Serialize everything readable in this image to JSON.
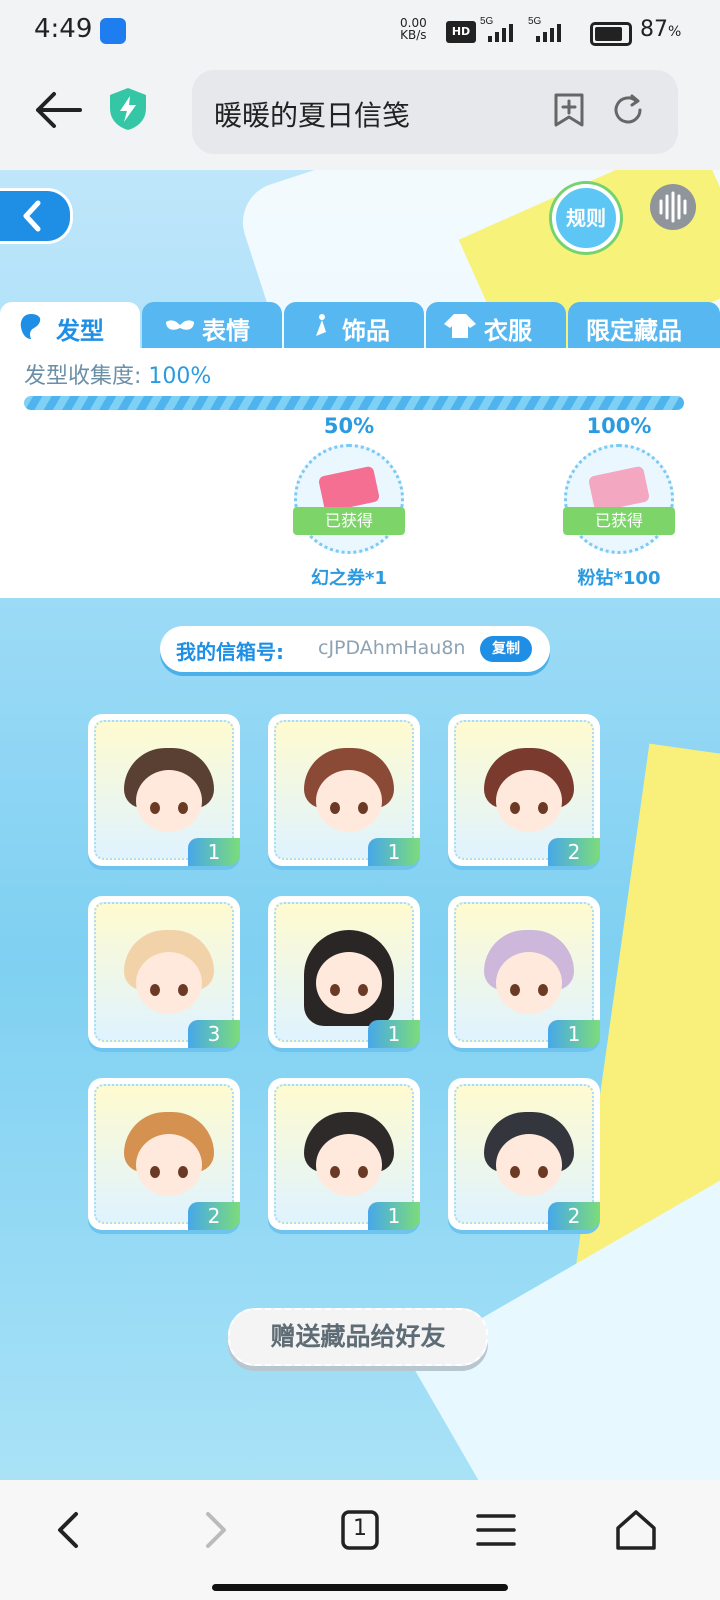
{
  "status_bar": {
    "time": "4:49",
    "net_speed_value": "0.00",
    "net_speed_unit": "KB/s",
    "hd_badge": "HD",
    "signal_labels": [
      "5G",
      "5G"
    ],
    "battery_percent": "87",
    "percent_sign": "%"
  },
  "browser": {
    "title": "暖暖的夏日信笺",
    "icons": [
      "back-arrow-icon",
      "shield-bolt-icon",
      "add-bookmark-icon",
      "refresh-icon"
    ]
  },
  "game": {
    "rules_label": "规则",
    "tabs": [
      {
        "label": "发型",
        "active": true,
        "icon": "hair-icon"
      },
      {
        "label": "表情",
        "active": false,
        "icon": "mask-icon"
      },
      {
        "label": "饰品",
        "active": false,
        "icon": "earring-icon"
      },
      {
        "label": "衣服",
        "active": false,
        "icon": "clothes-icon"
      },
      {
        "label": "限定藏品",
        "active": false,
        "icon": ""
      }
    ],
    "progress": {
      "label": "发型收集度:",
      "value": "100%",
      "fraction": 1.0
    },
    "milestones": [
      {
        "percent": "50%",
        "status": "已获得",
        "reward": "幻之券*1"
      },
      {
        "percent": "100%",
        "status": "已获得",
        "reward": "粉钻*100"
      }
    ],
    "mailbox": {
      "label": "我的信箱号:",
      "value": "cJPDAhmHau8n",
      "copy_label": "复制"
    },
    "items": [
      {
        "count": "1"
      },
      {
        "count": "1"
      },
      {
        "count": "2"
      },
      {
        "count": "3"
      },
      {
        "count": "1"
      },
      {
        "count": "1"
      },
      {
        "count": "2"
      },
      {
        "count": "1"
      },
      {
        "count": "2"
      }
    ],
    "gift_button": "赠送藏品给好友"
  },
  "nav_bar": {
    "tab_count": "1",
    "icons": [
      "back-icon",
      "forward-icon",
      "tabs-icon",
      "menu-icon",
      "home-icon"
    ]
  },
  "colors": {
    "accent_blue": "#1f8fe6",
    "tab_blue": "#56b7f1",
    "green_tag": "#7dd56a",
    "pink_gem": "#f46f92",
    "pink_diamond": "#f4a7c0"
  }
}
